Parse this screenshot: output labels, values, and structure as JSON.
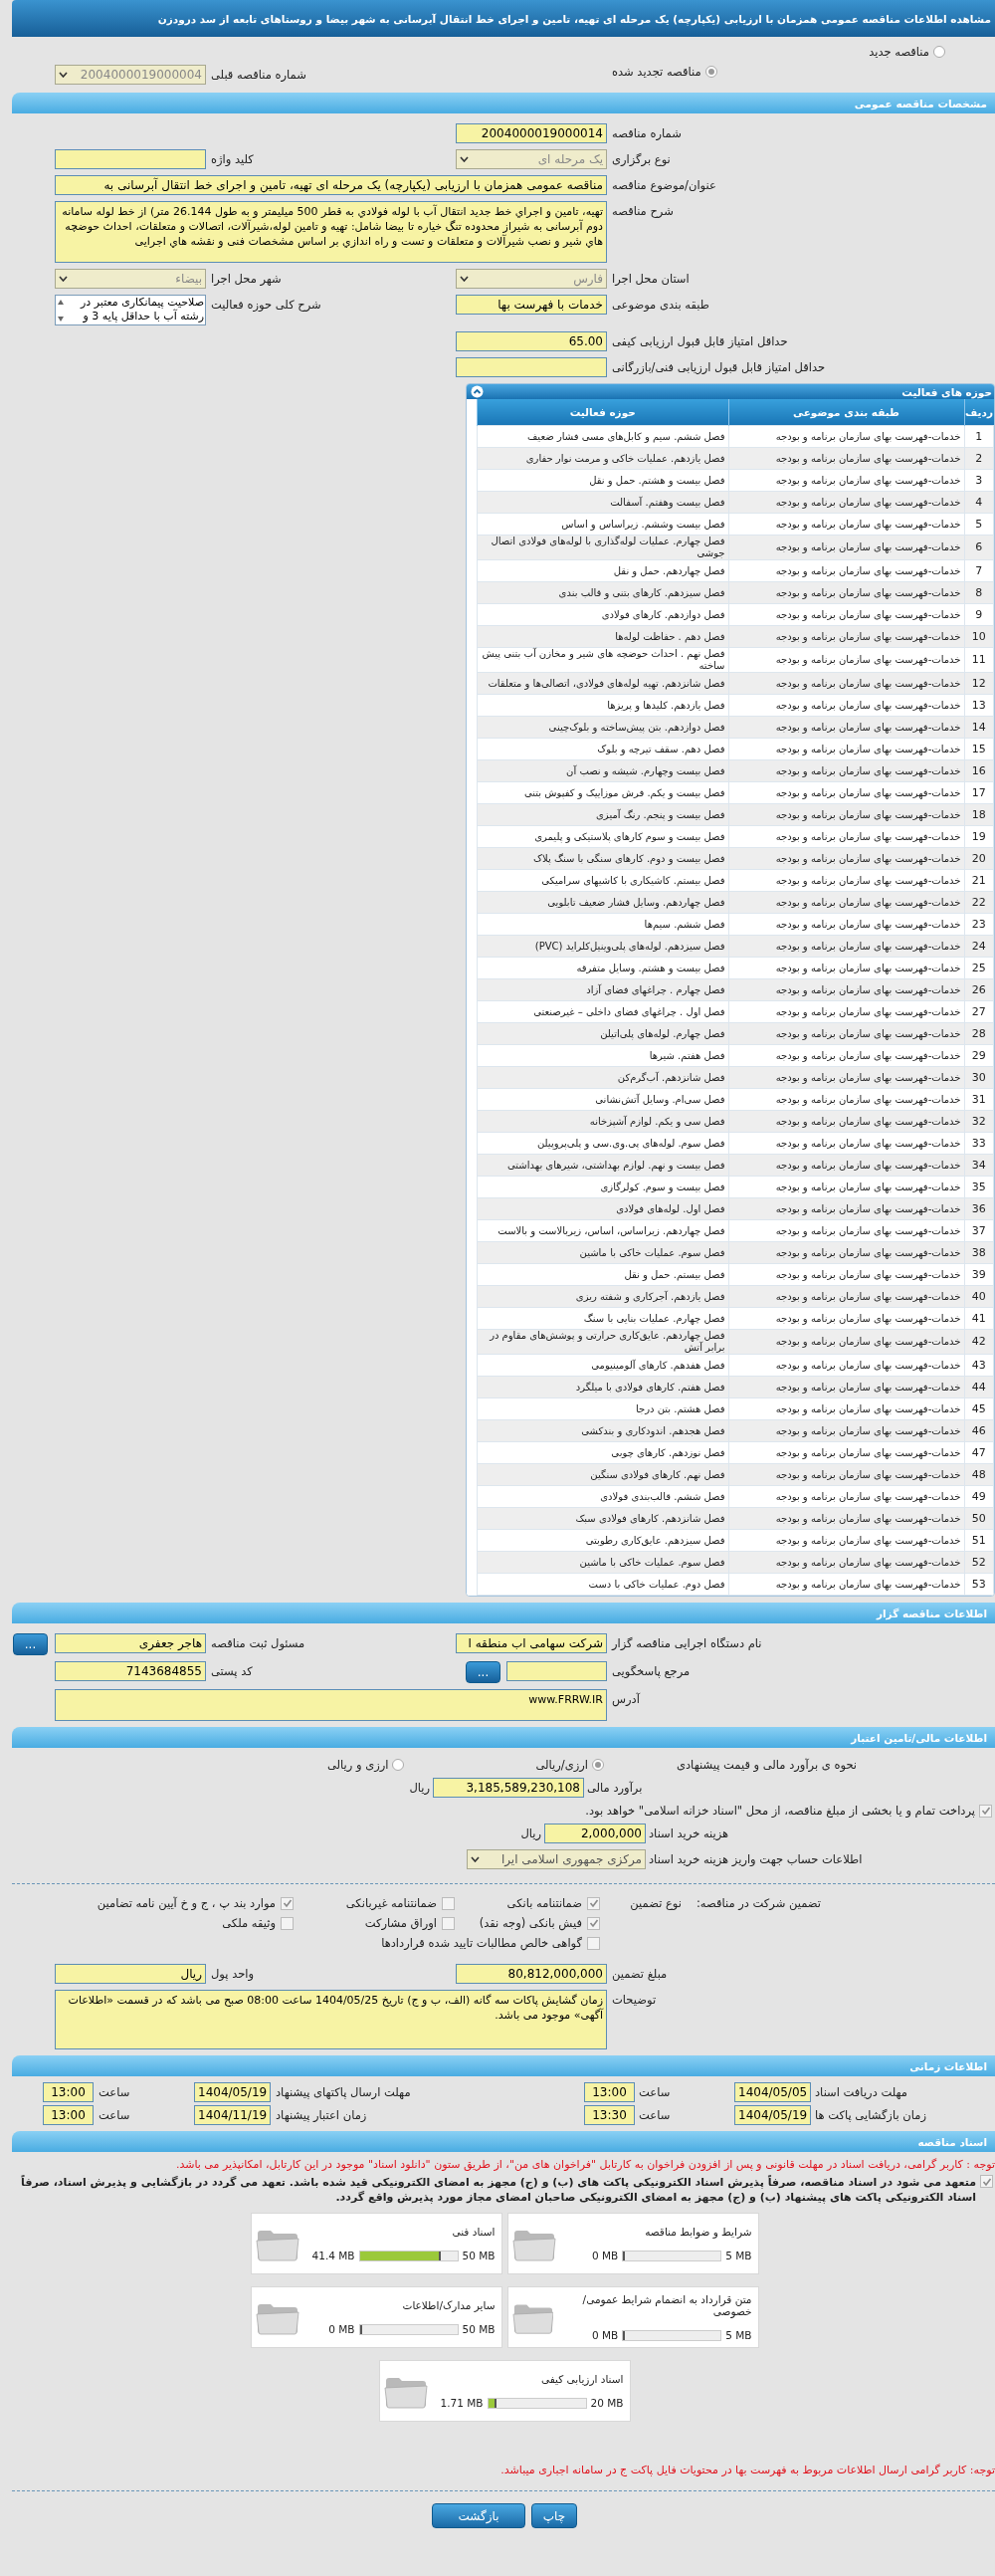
{
  "header": {
    "title": "مشاهده اطلاعات مناقصه عمومی همزمان با ارزیابی (یکپارچه) یک مرحله ای تهیه، تامین و اجرای خط انتقال آبرسانی به شهر بیضا و روستاهای تابعه از سد درودزن"
  },
  "tender_status": [
    {
      "label": "مناقصه جدید",
      "selected": false
    },
    {
      "label": "مناقصه تجدید شده",
      "selected": true
    }
  ],
  "previous_tender": {
    "label": "شماره مناقصه قبلی",
    "value": "2004000019000004",
    "kind": "select"
  },
  "general": {
    "title": "مشخصات مناقصه عمومی",
    "rows": [
      {
        "right": {
          "label": "شماره مناقصه",
          "value": "2004000019000014",
          "kind": "text"
        }
      },
      {
        "right": {
          "label": "نوع برگزاری",
          "value": "یک مرحله ای",
          "kind": "select"
        },
        "left": {
          "label": "کلید واژه",
          "kind": "text"
        }
      },
      {
        "wide": {
          "label": "عنوان/موضوع مناقصه",
          "value": "مناقصه عمومی همزمان با ارزیابی (یکپارچه) یک مرحله ای تهیه، تامین و اجرای خط انتقال آبرسانی به",
          "kind": "text"
        }
      },
      {
        "wide": {
          "label": "شرح مناقصه",
          "value": "تهیه، تامین و اجراي خط جدید انتقال آب با لوله فولادي به قطر 500 میلیمتر و به طول 26.144 متر) از خط لوله سامانه دوم آبرسانی به شیراز محدوده تنگ خیاره تا بیضا شامل: تهیه و تامین لوله،شیرآلات، اتصالات و متعلقات، احداث حوضچه هاي شیر و نصب شیرآلات و متعلقات و تست و راه اندازي بر اساس مشخصات فنی و نقشه هاي اجرایی",
          "kind": "textarea"
        }
      },
      {
        "right": {
          "label": "استان محل اجرا",
          "value": "فارس",
          "kind": "select"
        },
        "left": {
          "label": "شهر محل اجرا",
          "value": "بیضاء",
          "kind": "select"
        }
      },
      {
        "right": {
          "label": "طبقه بندی موضوعی",
          "value": "خدمات با فهرست بها",
          "kind": "text"
        },
        "left": {
          "label": "شرح کلی حوزه فعالیت",
          "value": "صلاحیت پیمانکاری معتبر در رشته آب با حداقل پایه 3 و",
          "kind": "listbox"
        }
      },
      {
        "right": {
          "label": "حداقل امتیاز قابل قبول ارزیابی کیفی",
          "value": "65.00",
          "kind": "text"
        }
      },
      {
        "right": {
          "label": "حداقل امتیاز قابل قبول ارزیابی فنی/بازرگانی",
          "kind": "text"
        }
      }
    ]
  },
  "activities": {
    "title": "حوزه های فعالیت",
    "columns": [
      "ردیف",
      "طبقه بندی موضوعی",
      "حوزه فعالیت"
    ],
    "rows": [
      {
        "index": "1",
        "category": "خدمات-فهرست بهای سازمان برنامه و بودجه",
        "activity": "فصل ششم. سیم و کابل‌های مسی فشار ضعیف"
      },
      {
        "index": "2",
        "category": "خدمات-فهرست بهای سازمان برنامه و بودجه",
        "activity": "فصل یازدهم. عملیات خاکی و مرمت نوار حفاری"
      },
      {
        "index": "3",
        "category": "خدمات-فهرست بهای سازمان برنامه و بودجه",
        "activity": "فصل بیست و هشتم. حمل و نقل"
      },
      {
        "index": "4",
        "category": "خدمات-فهرست بهای سازمان برنامه و بودجه",
        "activity": "فصل بیست وهفتم. آسفالت"
      },
      {
        "index": "5",
        "category": "خدمات-فهرست بهای سازمان برنامه و بودجه",
        "activity": "فصل بیست وششم. زیراساس و اساس"
      },
      {
        "index": "6",
        "category": "خدمات-فهرست بهای سازمان برنامه و بودجه",
        "activity": "فصل چهارم. عملیات لوله‌گذاری با لوله‌های فولادی اتصال جوشی"
      },
      {
        "index": "7",
        "category": "خدمات-فهرست بهای سازمان برنامه و بودجه",
        "activity": "فصل چهاردهم. حمل و نقل"
      },
      {
        "index": "8",
        "category": "خدمات-فهرست بهای سازمان برنامه و بودجه",
        "activity": "فصل سیزدهم. کارهای بتنی و قالب بندی"
      },
      {
        "index": "9",
        "category": "خدمات-فهرست بهای سازمان برنامه و بودجه",
        "activity": "فصل دوازدهم. کارهای فولادی"
      },
      {
        "index": "10",
        "category": "خدمات-فهرست بهای سازمان برنامه و بودجه",
        "activity": "فصل دهم . حفاظت لوله‌ها"
      },
      {
        "index": "11",
        "category": "خدمات-فهرست بهای سازمان برنامه و بودجه",
        "activity": "فصل نهم . احداث حوضچه های شیر و مخازن آب بتنی پیش ساخته"
      },
      {
        "index": "12",
        "category": "خدمات-فهرست بهای سازمان برنامه و بودجه",
        "activity": "فصل شانزدهم. تهیه لوله‌های فولادی، اتصالی‌ها و متعلقات"
      },
      {
        "index": "13",
        "category": "خدمات-فهرست بهای سازمان برنامه و بودجه",
        "activity": "فصل یازدهم. کلیدها و پریزها"
      },
      {
        "index": "14",
        "category": "خدمات-فهرست بهای سازمان برنامه و بودجه",
        "activity": "فصل دوازدهم. بتن پیش‌ساخته و بلوک‌چینی"
      },
      {
        "index": "15",
        "category": "خدمات-فهرست بهای سازمان برنامه و بودجه",
        "activity": "فصل دهم. سقف تیرچه و بلوک"
      },
      {
        "index": "16",
        "category": "خدمات-فهرست بهای سازمان برنامه و بودجه",
        "activity": "فصل بیست وچهارم. شیشه و نصب آن"
      },
      {
        "index": "17",
        "category": "خدمات-فهرست بهای سازمان برنامه و بودجه",
        "activity": "فصل بیست و یکم. فرش موزاییک و کفپوش بتنی"
      },
      {
        "index": "18",
        "category": "خدمات-فهرست بهای سازمان برنامه و بودجه",
        "activity": "فصل بیست و پنجم. رنگ آمیزی"
      },
      {
        "index": "19",
        "category": "خدمات-فهرست بهای سازمان برنامه و بودجه",
        "activity": "فصل بیست و سوم کارهای پلاستیکی و پلیمری"
      },
      {
        "index": "20",
        "category": "خدمات-فهرست بهای سازمان برنامه و بودجه",
        "activity": "فصل بیست و دوم. کارهای سنگی با سنگ پلاک"
      },
      {
        "index": "21",
        "category": "خدمات-فهرست بهای سازمان برنامه و بودجه",
        "activity": "فصل بیستم. کاشیکاری با کاشیهای سرامیکی"
      },
      {
        "index": "22",
        "category": "خدمات-فهرست بهای سازمان برنامه و بودجه",
        "activity": "فصل چهاردهم. وسایل فشار ضعیف تابلویی"
      },
      {
        "index": "23",
        "category": "خدمات-فهرست بهای سازمان برنامه و بودجه",
        "activity": "فصل ششم. سیم‌ها"
      },
      {
        "index": "24",
        "category": "خدمات-فهرست بهای سازمان برنامه و بودجه",
        "activity": "فصل سیزدهم. لوله‌های پلی‌وینیل‌کلراید (PVC)"
      },
      {
        "index": "25",
        "category": "خدمات-فهرست بهای سازمان برنامه و بودجه",
        "activity": "فصل بیست و هشتم. وسایل متفرقه"
      },
      {
        "index": "26",
        "category": "خدمات-فهرست بهای سازمان برنامه و بودجه",
        "activity": "فصل چهارم . چراغهای فضای آزاد"
      },
      {
        "index": "27",
        "category": "خدمات-فهرست بهای سازمان برنامه و بودجه",
        "activity": "فصل اول . چراغهای فضای داخلی – غیرصنعتی"
      },
      {
        "index": "28",
        "category": "خدمات-فهرست بهای سازمان برنامه و بودجه",
        "activity": "فصل چهارم. لوله‌های پلی‌اتیلن"
      },
      {
        "index": "29",
        "category": "خدمات-فهرست بهای سازمان برنامه و بودجه",
        "activity": "فصل هفتم. شیرها"
      },
      {
        "index": "30",
        "category": "خدمات-فهرست بهای سازمان برنامه و بودجه",
        "activity": "فصل شانزدهم. آب‌گرم‌کن"
      },
      {
        "index": "31",
        "category": "خدمات-فهرست بهای سازمان برنامه و بودجه",
        "activity": "فصل سی‌ام. وسایل آتش‌نشانی"
      },
      {
        "index": "32",
        "category": "خدمات-فهرست بهای سازمان برنامه و بودجه",
        "activity": "فصل سی و یکم. لوازم آشپزخانه"
      },
      {
        "index": "33",
        "category": "خدمات-فهرست بهای سازمان برنامه و بودجه",
        "activity": "فصل سوم. لوله‌های پی.وی.سی و پلی‌پروپیلن"
      },
      {
        "index": "34",
        "category": "خدمات-فهرست بهای سازمان برنامه و بودجه",
        "activity": "فصل بیست و نهم. لوازم بهداشتی، شیرهای بهداشتی"
      },
      {
        "index": "35",
        "category": "خدمات-فهرست بهای سازمان برنامه و بودجه",
        "activity": "فصل بیست و سوم. کولرگازی"
      },
      {
        "index": "36",
        "category": "خدمات-فهرست بهای سازمان برنامه و بودجه",
        "activity": "فصل اول. لوله‌های فولادی"
      },
      {
        "index": "37",
        "category": "خدمات-فهرست بهای سازمان برنامه و بودجه",
        "activity": "فصل چهاردهم. زیراساس، اساس، زیربالاست  و بالاست"
      },
      {
        "index": "38",
        "category": "خدمات-فهرست بهای سازمان برنامه و بودجه",
        "activity": "فصل سوم. عملیات خاکی با ماشین"
      },
      {
        "index": "39",
        "category": "خدمات-فهرست بهای سازمان برنامه و بودجه",
        "activity": "فصل بیستم. حمل و نقل"
      },
      {
        "index": "40",
        "category": "خدمات-فهرست بهای سازمان برنامه و بودجه",
        "activity": "فصل یازدهم. آجرکاری و شفته ریزی"
      },
      {
        "index": "41",
        "category": "خدمات-فهرست بهای سازمان برنامه و بودجه",
        "activity": "فصل چهارم. عملیات بنایی با سنگ"
      },
      {
        "index": "42",
        "category": "خدمات-فهرست بهای سازمان برنامه و بودجه",
        "activity": "فصل چهاردهم. عایق‌کاری حرارتی و پوشش‌های مقاوم در برابر آتش"
      },
      {
        "index": "43",
        "category": "خدمات-فهرست بهای سازمان برنامه و بودجه",
        "activity": "فصل هفدهم. کارهای آلومینیومی"
      },
      {
        "index": "44",
        "category": "خدمات-فهرست بهای سازمان برنامه و بودجه",
        "activity": "فصل هفتم. کارهای فولادی با میلگرد"
      },
      {
        "index": "45",
        "category": "خدمات-فهرست بهای سازمان برنامه و بودجه",
        "activity": "فصل هشتم. بتن درجا"
      },
      {
        "index": "46",
        "category": "خدمات-فهرست بهای سازمان برنامه و بودجه",
        "activity": "فصل هجدهم. اندودکاری و بندکشی"
      },
      {
        "index": "47",
        "category": "خدمات-فهرست بهای سازمان برنامه و بودجه",
        "activity": "فصل نوزدهم. کارهای چوبی"
      },
      {
        "index": "48",
        "category": "خدمات-فهرست بهای سازمان برنامه و بودجه",
        "activity": "فصل نهم. کارهای فولادی سنگین"
      },
      {
        "index": "49",
        "category": "خدمات-فهرست بهای سازمان برنامه و بودجه",
        "activity": "فصل ششم. قالب‌بندی فولادی"
      },
      {
        "index": "50",
        "category": "خدمات-فهرست بهای سازمان برنامه و بودجه",
        "activity": "فصل شانزدهم. کارهای فولادی سبک"
      },
      {
        "index": "51",
        "category": "خدمات-فهرست بهای سازمان برنامه و بودجه",
        "activity": "فصل سیزدهم. عایق‌کاری رطوبتی"
      },
      {
        "index": "52",
        "category": "خدمات-فهرست بهای سازمان برنامه و بودجه",
        "activity": "فصل سوم. عملیات خاکی با ماشین"
      },
      {
        "index": "53",
        "category": "خدمات-فهرست بهای سازمان برنامه و بودجه",
        "activity": "فصل دوم. عملیات خاکی با دست"
      }
    ]
  },
  "authority": {
    "title": "اطلاعات مناقصه گزار",
    "rows": [
      {
        "right": {
          "label": "نام دستگاه اجرایی مناقصه گزار",
          "value": "شرکت سهامی اب منطقه ا",
          "kind": "text"
        },
        "left": {
          "label": "مسئول ثبت مناقصه",
          "value": "هاجر جعفری",
          "kind": "text_button",
          "button": "..."
        }
      },
      {
        "right": {
          "label": "مرجع پاسخگویی",
          "kind": "text_button",
          "button": "..."
        },
        "left": {
          "label": "کد پستی",
          "value": "7143684855",
          "kind": "text"
        }
      },
      {
        "wide": {
          "label": "آدرس",
          "value": "www.FRRW.IR",
          "kind": "address"
        }
      }
    ]
  },
  "finance": {
    "title": "اطلاعات مالی/تامین اعتبار",
    "estimate_method": {
      "label": "نحوه ی برآورد مالی و قیمت پیشنهادی",
      "options": [
        {
          "label": "ارزی/ریالی",
          "selected": true
        },
        {
          "label": "ارزی و ریالی",
          "selected": false
        }
      ]
    },
    "budget": {
      "label": "برآورد مالی",
      "value": "3,185,589,230,108",
      "unit": "ریال"
    },
    "treasury": {
      "label": "پرداخت تمام و یا بخشی از مبلغ مناقصه، از محل \"اسناد خزانه اسلامی\" خواهد بود.",
      "checked": true
    },
    "doc_fee": {
      "label": "هزینه خرید اسناد",
      "value": "2,000,000",
      "unit": "ریال"
    },
    "account": {
      "label": "اطلاعات حساب جهت واریز هزینه خرید اسناد",
      "value": "مرکزی جمهوری اسلامی ایرا"
    },
    "guarantee": {
      "title": "تضمین شرکت در مناقصه:",
      "type_label": "نوع تضمین",
      "options": [
        {
          "label": "ضمانتنامه بانکی",
          "checked": true
        },
        {
          "label": "ضمانتنامه غیربانکی",
          "checked": false
        },
        {
          "label": "موارد بند پ ، ج و خ آیین نامه تضامین",
          "checked": true
        },
        {
          "label": "فیش بانکی (وجه نقد)",
          "checked": true
        },
        {
          "label": "اوراق مشارکت",
          "checked": false
        },
        {
          "label": "وثیقه ملکی",
          "checked": false
        },
        {
          "label": "گواهی خالص مطالبات تایید شده قراردادها",
          "checked": false
        }
      ]
    },
    "rows": [
      {
        "right": {
          "label": "مبلغ تضمین",
          "value": "80,812,000,000",
          "kind": "text"
        },
        "left": {
          "label": "واحد پول",
          "value": "ریال",
          "kind": "text"
        }
      },
      {
        "wide": {
          "label": "توضیحات",
          "value": "زمان گشایش پاکات سه گانه (الف، ب و ج) تاریخ 1404/05/25 ساعت 08:00 صبح می باشد که در قسمت «اطلاعات آگهی» موجود می باشد.",
          "kind": "textarea"
        }
      }
    ]
  },
  "timing": {
    "title": "اطلاعات زمانی",
    "rows": [
      {
        "right": {
          "label": "مهلت دریافت اسناد",
          "date": "1404/05/05",
          "time_label": "ساعت",
          "time": "13:00"
        },
        "left": {
          "label": "مهلت ارسال پاکتهای پیشنهاد",
          "date": "1404/05/19",
          "time_label": "ساعت",
          "time": "13:00"
        }
      },
      {
        "right": {
          "label": "زمان بازگشایی پاکت ها",
          "date": "1404/05/19",
          "time_label": "ساعت",
          "time": "13:30"
        },
        "left": {
          "label": "زمان اعتبار پیشنهاد",
          "date": "1404/11/19",
          "time_label": "ساعت",
          "time": "13:00"
        }
      }
    ]
  },
  "documents": {
    "title": "اسناد مناقصه",
    "notice": "توجه : کاربر گرامی، دریافت اسناد در مهلت قانونی و پس از افزودن فراخوان به کارتابل \"فراخوان های من\"، از طریق ستون \"دانلود اسناد\" موجود در این کارتابل، امکانپذیر می باشد.",
    "commitment": {
      "label": "متعهد می شود در اسناد مناقصه، صرفاً پذیرش اسناد الکترونیکی پاکت های (ب) و (ج) مجهز به امضای الکترونیکی قید شده باشد. تعهد می گردد در بازگشایی و پذیرش اسناد، صرفاً اسناد الکترونیکی پاکت های پیشنهاد (ب) و (ج) مجهز به امضای الکترونیکی صاحبان امضای مجاز مورد پذیرش واقع گردد.",
      "checked": true
    },
    "files": [
      {
        "title": "شرایط و ضوابط مناقصه",
        "used": "0 MB",
        "capacity": "5 MB",
        "level": 0
      },
      {
        "title": "اسناد فنی",
        "used": "41.4 MB",
        "capacity": "50 MB",
        "level": 0.828
      },
      {
        "title": "متن قرارداد به انضمام شرایط عمومی/خصوصی",
        "used": "0 MB",
        "capacity": "5 MB",
        "level": 0
      },
      {
        "title": "سایر مدارک/اطلاعات",
        "used": "0 MB",
        "capacity": "50 MB",
        "level": 0
      },
      {
        "title": "اسناد ارزیابی کیفی",
        "used": "1.71 MB",
        "capacity": "20 MB",
        "level": 0.0855
      }
    ],
    "note": "توجه: کاربر گرامی ارسال اطلاعات مربوط به فهرست بها در محتویات فایل پاکت ج در سامانه اجباری میباشد."
  },
  "buttons": [
    {
      "label": "چاپ",
      "kind": "print"
    },
    {
      "label": "بازگشت",
      "kind": "back"
    }
  ]
}
